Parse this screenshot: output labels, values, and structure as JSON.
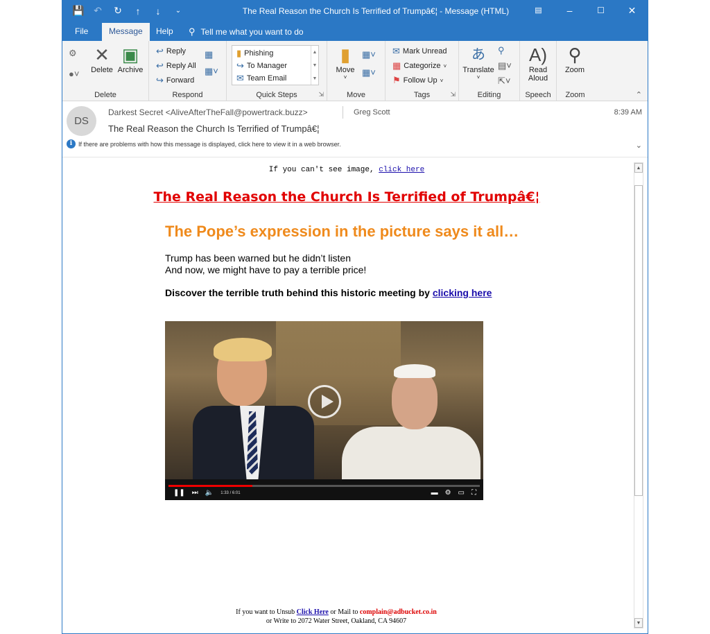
{
  "window": {
    "title": "The Real Reason the Church Is Terrified of Trumpâ€¦ - Message (HTML)",
    "qat": {
      "save_icon": "save-icon",
      "undo_icon": "undo-icon",
      "redo_icon": "redo-icon",
      "up_icon": "arrow-up-icon",
      "down_icon": "arrow-down-icon",
      "customize": "⌄"
    }
  },
  "tabs": [
    {
      "label": "File"
    },
    {
      "label": "Message"
    },
    {
      "label": "Help"
    }
  ],
  "tell_me": "Tell me what you want to do",
  "ribbon": {
    "delete_group": {
      "label": "Delete",
      "delete": "Delete",
      "archive": "Archive"
    },
    "respond_group": {
      "label": "Respond",
      "reply": "Reply",
      "reply_all": "Reply All",
      "forward": "Forward"
    },
    "quick_steps_group": {
      "label": "Quick Steps",
      "items": [
        "Phishing",
        "To Manager",
        "Team Email"
      ]
    },
    "move_group": {
      "label": "Move",
      "move": "Move"
    },
    "tags_group": {
      "label": "Tags",
      "mark_unread": "Mark Unread",
      "categorize": "Categorize",
      "follow_up": "Follow Up"
    },
    "editing_group": {
      "label": "Editing",
      "translate": "Translate"
    },
    "speech_group": {
      "label": "Speech",
      "read_aloud_1": "Read",
      "read_aloud_2": "Aloud"
    },
    "zoom_group": {
      "label": "Zoom",
      "zoom": "Zoom"
    }
  },
  "header": {
    "avatar_initials": "DS",
    "from": "Darkest Secret <AliveAfterTheFall@powertrack.buzz>",
    "to": "Greg Scott",
    "time": "8:39 AM",
    "subject": "The Real Reason the Church Is Terrified of Trumpâ€¦",
    "info": "If there are problems with how this message is displayed, click here to view it in a web browser."
  },
  "email": {
    "cant_see_prefix": "If you can't see image,",
    "cant_see_link": "click here",
    "headline": "The Real Reason the Church Is Terrified of Trumpâ€¦",
    "sub_headline": "The Pope’s expression in the picture says it all…",
    "line1": "Trump has been warned but he didn’t listen",
    "line2": "And now, we might have to pay a terrible price!",
    "discover_prefix": "Discover the terrible truth behind this historic meeting by",
    "discover_link": "clicking here",
    "video": {
      "time": "1:33 / 6:01",
      "progress": 0.27
    },
    "footer_prefix": "If you want to Unsub",
    "footer_link": "Click Here",
    "footer_mid": "or Mail to",
    "footer_email": "complain@adbucket.co.in",
    "footer_line2": "or Write to 2072 Water Street, Oakland, CA 94607"
  },
  "colors": {
    "accent": "#2b78c5",
    "headline": "#e10000",
    "sub_headline": "#ef8a1c",
    "link": "#1a0dab"
  }
}
